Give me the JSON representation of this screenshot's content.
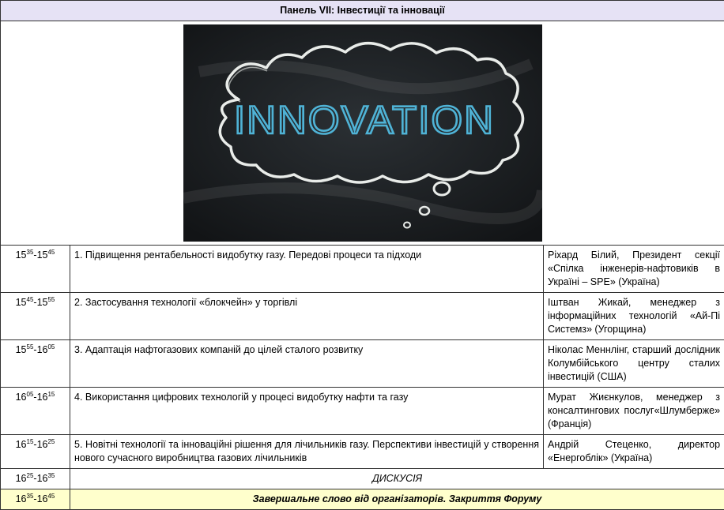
{
  "panel_title": "Панель VII: Інвестиції та інновації",
  "image": {
    "chalk_text": "INNOVATION",
    "board_color": "#1e2226",
    "chalk_color": "#e9ece9",
    "word_color": "#4fb3d6"
  },
  "rows": [
    {
      "start_h": "15",
      "start_m": "35",
      "end_h": "15",
      "end_m": "45",
      "topic": "1. Підвищення рентабельності видобутку газу. Передові процеси та підходи",
      "speaker": "Ріхард Білий, Президент секції «Спілка інженерів-нафтовиків в Україні – SPE» (Україна)"
    },
    {
      "start_h": "15",
      "start_m": "45",
      "end_h": "15",
      "end_m": "55",
      "topic": "2. Застосування технології «блокчейн» у торгівлі",
      "speaker": "Іштван Жикай, менеджер з інформаційних технологій «Ай-Пі Системз» (Угорщина)"
    },
    {
      "start_h": "15",
      "start_m": "55",
      "end_h": "16",
      "end_m": "05",
      "topic": "3. Адаптація нафтогазових компаній до цілей сталого розвитку",
      "speaker": "Ніколас Меннлінг, старший дослідник Колумбійського центру сталих інвестицій (США)"
    },
    {
      "start_h": "16",
      "start_m": "05",
      "end_h": "16",
      "end_m": "15",
      "topic": "4. Використання цифрових технологій у процесі видобутку нафти та газу",
      "speaker": "Мурат Жиєнкулов, менеджер з консалтингових послуг«Шлумберже» (Франція)"
    },
    {
      "start_h": "16",
      "start_m": "15",
      "end_h": "16",
      "end_m": "25",
      "topic": "5. Новітні технології та інноваційні рішення для лічильників газу. Перспективи інвестицій у створення нового сучасного виробництва газових лічильників",
      "speaker": "Андрій Стеценко, директор «Енергоблік» (Україна)"
    }
  ],
  "discussion": {
    "start_h": "16",
    "start_m": "25",
    "end_h": "16",
    "end_m": "35",
    "text": "ДИСКУСІЯ"
  },
  "closing": {
    "start_h": "16",
    "start_m": "35",
    "end_h": "16",
    "end_m": "45",
    "text": "Завершальне слово від організаторів. Закриття Форуму",
    "background": "#ffffcc"
  }
}
